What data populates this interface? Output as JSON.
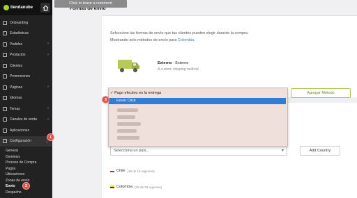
{
  "sidebar": {
    "logo_text": "tiendanube",
    "items": [
      {
        "label": "Onboarding",
        "icon": "check-icon",
        "chevron": false
      },
      {
        "label": "Estadísticas",
        "icon": "chart-icon",
        "chevron": false
      },
      {
        "label": "Pedidos",
        "icon": "cart-icon",
        "chevron": true
      },
      {
        "label": "Productos",
        "icon": "tag-icon",
        "chevron": true
      },
      {
        "label": "Clientes",
        "icon": "user-icon",
        "chevron": false
      },
      {
        "label": "Promociones",
        "icon": "percent-icon",
        "chevron": false
      },
      {
        "label": "Páginas",
        "icon": "page-icon",
        "chevron": true
      },
      {
        "label": "Idiomas",
        "icon": "globe-icon",
        "chevron": false
      },
      {
        "label": "Temas",
        "icon": "palette-icon",
        "chevron": true
      },
      {
        "label": "Canales de venta",
        "icon": "store-icon",
        "chevron": true
      },
      {
        "label": "Aplicaciones",
        "icon": "apps-icon",
        "chevron": false
      },
      {
        "label": "Configuración",
        "icon": "gear-icon",
        "chevron": true
      }
    ],
    "sub_items": [
      "General",
      "Dominios",
      "Proceso de Compra",
      "Pagos",
      "Ubicaciones",
      "Zonas de envío",
      "Envío",
      "Despacho"
    ],
    "active_sub": "Envío"
  },
  "tooltip": "Click to leave a comment",
  "page_title": "Formas de envío",
  "intro": {
    "line1": "Seleccione las formas de envío que tus clientes pueden elegir durante la compra.",
    "line2_prefix": "Mostrando solo métodos de envío para ",
    "line2_link": "Colombia."
  },
  "shipping": {
    "name": "Externo",
    "name_suffix": " - Externo",
    "desc": "A custom shipping method"
  },
  "dropdown": {
    "selected_option": "✓ Pago efectivo en la entrega",
    "highlighted_option": "Envío Click"
  },
  "agregar_label": "Agregar Método",
  "country_select_placeholder": "Selecciona un país...",
  "add_country_label": "Add Country",
  "countries": [
    {
      "name": "Chile",
      "meta": "(16 de 16 regiones)"
    },
    {
      "name": "Colombia",
      "meta": "(29 de 33 regiones)"
    }
  ],
  "badges": [
    "1",
    "2",
    "3"
  ],
  "colors": {
    "accent_green": "#a6c74f",
    "highlight_blue": "#2f7dd6",
    "badge_red": "#e0514d"
  }
}
